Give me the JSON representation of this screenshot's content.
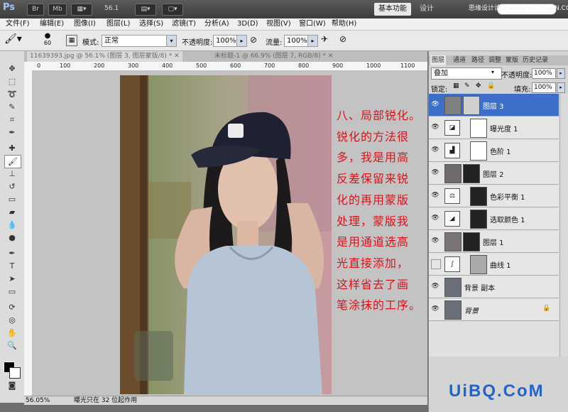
{
  "titlebar": {
    "app_logo": "Ps",
    "br": "Br",
    "mb": "Mb",
    "zoom": "56.1",
    "workspace_active": "基本功能",
    "workspace_design": "设计",
    "watermark": "思缘设计论坛 www.MISSYUAN.COM"
  },
  "menu": [
    "文件(F)",
    "编辑(E)",
    "图像(I)",
    "图层(L)",
    "选择(S)",
    "滤镜(T)",
    "分析(A)",
    "3D(D)",
    "视图(V)",
    "窗口(W)",
    "帮助(H)"
  ],
  "options": {
    "brush_size": "60",
    "mode_label": "模式:",
    "mode_value": "正常",
    "opacity_label": "不透明度:",
    "opacity_value": "100%",
    "flow_label": "流量:",
    "flow_value": "100%"
  },
  "document": {
    "tab1": "11639393.jpg @ 56.1% (图层 3, 图层蒙版/8) *",
    "tab2": "未标题-1 @ 66.9% (图层 7, RGB/8) *",
    "ruler_ticks": [
      "0",
      "100",
      "200",
      "300",
      "400",
      "500",
      "600",
      "700",
      "800",
      "900",
      "1000",
      "1100"
    ],
    "status_zoom": "56.05%",
    "status_info": "曝光只在 32 位起作用"
  },
  "note": {
    "lines": [
      "八、局部锐化。",
      "锐化的方法很",
      "多，我是用高",
      "反差保留来锐",
      "化的再用蒙版",
      "处理，蒙版我",
      "是用通道选高",
      "光直接添加，",
      "这样省去了画",
      "笔涂抹的工序。"
    ]
  },
  "panel": {
    "tabs": [
      "图层",
      "通道",
      "路径",
      "调整",
      "蒙版",
      "历史记录"
    ],
    "blend_mode": "叠加",
    "opacity_label": "不透明度:",
    "opacity_value": "100%",
    "lock_label": "锁定:",
    "fill_label": "填充:",
    "fill_value": "100%",
    "layers": [
      {
        "name": "图层 3",
        "kind": "pixel-mask",
        "selected": true
      },
      {
        "name": "曝光度 1",
        "kind": "adjustment",
        "icon": "exposure-icon"
      },
      {
        "name": "色阶 1",
        "kind": "adjustment",
        "icon": "levels-icon"
      },
      {
        "name": "图层 2",
        "kind": "pixel-mask"
      },
      {
        "name": "色彩平衡 1",
        "kind": "adjustment",
        "icon": "color-balance-icon"
      },
      {
        "name": "选取颜色 1",
        "kind": "adjustment",
        "icon": "selective-color-icon"
      },
      {
        "name": "图层 1",
        "kind": "pixel-mask"
      },
      {
        "name": "曲线 1",
        "kind": "adjustment",
        "icon": "curves-icon",
        "hidden": true
      },
      {
        "name": "背景 副本",
        "kind": "pixel"
      },
      {
        "name": "背景",
        "kind": "background",
        "locked": true
      }
    ]
  },
  "watermark_bottom": "UiBQ.CoM"
}
